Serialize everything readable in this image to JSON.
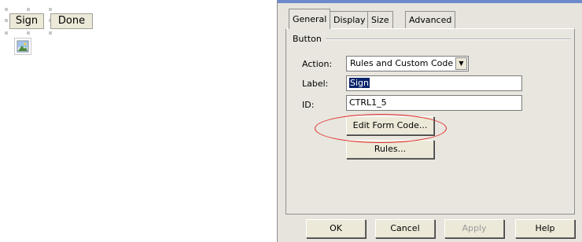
{
  "canvas": {
    "buttons": [
      {
        "label": "Sign"
      },
      {
        "label": "Done"
      }
    ],
    "image_control_icon": "image-placeholder-icon"
  },
  "dialog": {
    "tabs": [
      {
        "label": "General",
        "active": true
      },
      {
        "label": "Display",
        "active": false
      },
      {
        "label": "Size",
        "active": false
      },
      {
        "label": "Advanced",
        "active": false
      }
    ],
    "group_label": "Button",
    "action": {
      "label": "Action:",
      "value": "Rules and Custom Code"
    },
    "label_field": {
      "label": "Label:",
      "value": "Sign"
    },
    "id_field": {
      "label": "ID:",
      "value": "CTRL1_5"
    },
    "edit_form_code_button": "Edit Form Code...",
    "rules_button": "Rules...",
    "footer": {
      "ok": "OK",
      "cancel": "Cancel",
      "apply": "Apply",
      "help": "Help"
    }
  },
  "annotation": {
    "color": "#e02828",
    "highlights": "Edit Form Code..."
  },
  "colors": {
    "dialog_bg": "#e6e4dc",
    "selection": "#0a246a",
    "title_strip": "#6d8bcb"
  }
}
